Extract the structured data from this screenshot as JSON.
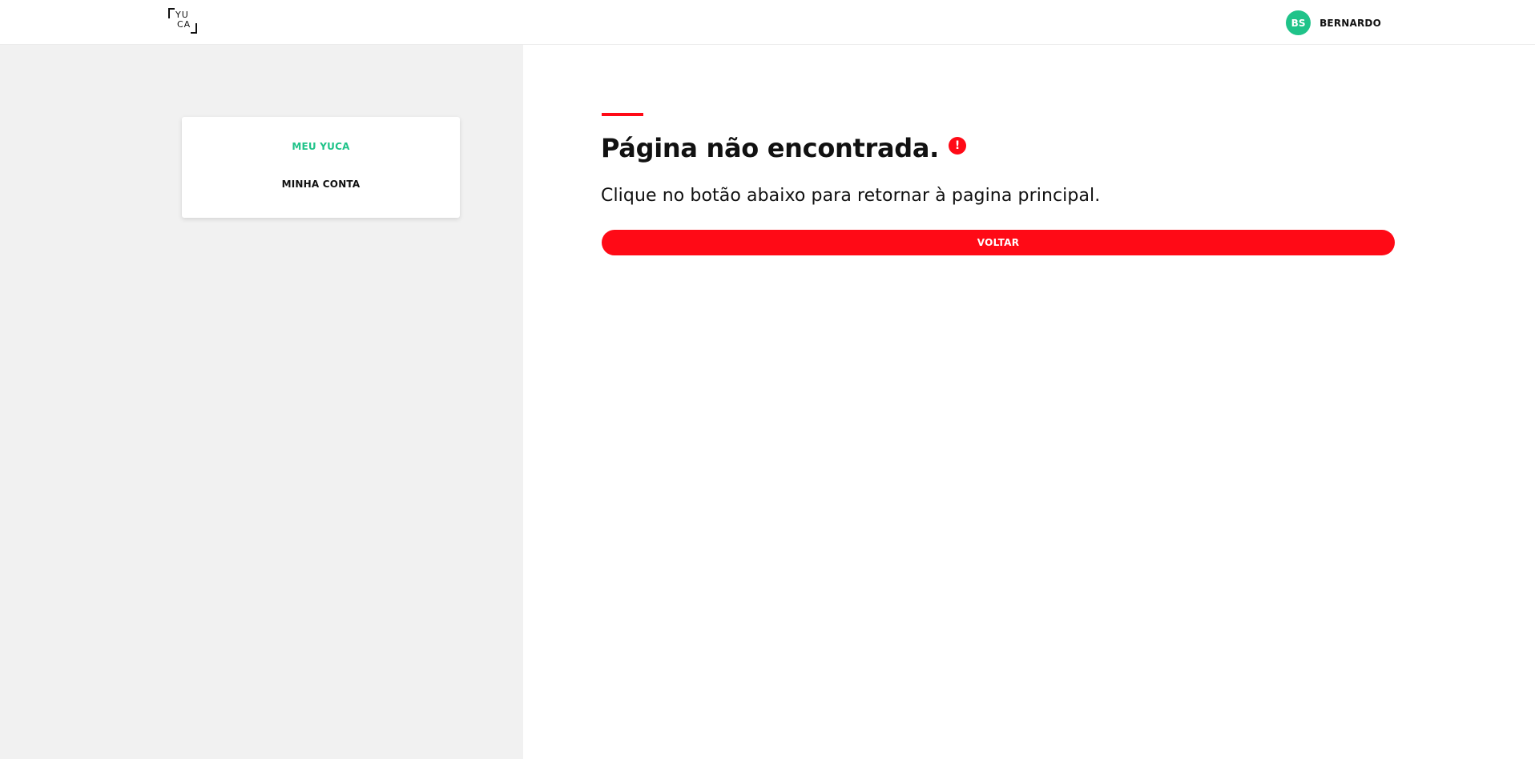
{
  "header": {
    "logo": {
      "line1": "YU",
      "line2": "CA"
    },
    "user": {
      "initials": "BS",
      "name": "BERNARDO",
      "avatar_color": "#1fc389"
    }
  },
  "sidebar": {
    "items": [
      {
        "label": "MEU YUCA",
        "active": true
      },
      {
        "label": "MINHA CONTA",
        "active": false
      }
    ]
  },
  "main": {
    "title": "Página não encontrada.",
    "alert_icon": "!",
    "subtitle": "Clique no botão abaixo para retornar à pagina principal.",
    "button_label": "VOLTAR"
  },
  "colors": {
    "accent": "#ff0a16",
    "active_menu": "#1fc389",
    "sidebar_bg": "#f1f1f1"
  }
}
